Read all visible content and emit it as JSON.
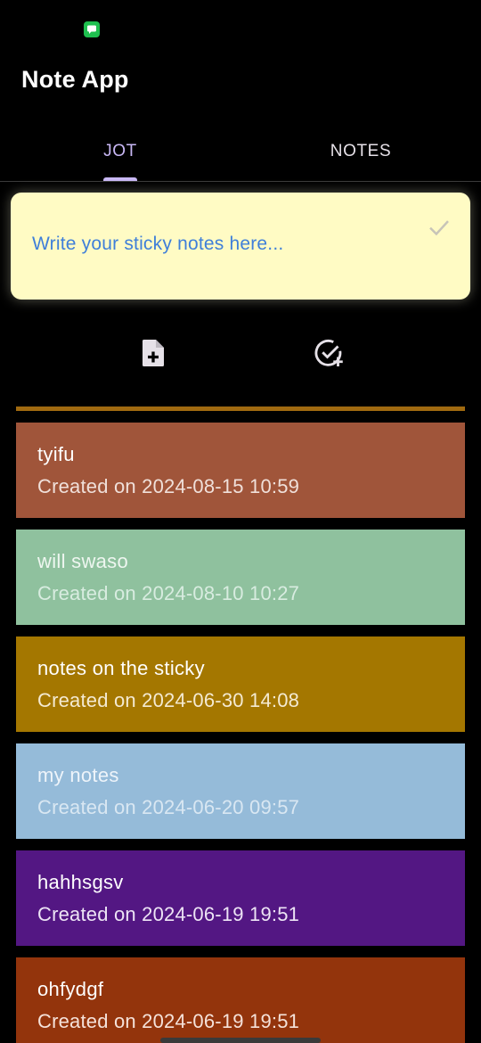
{
  "status_bar": {
    "app_icon": "chat-bubble-icon",
    "app_icon_color": "#1fbf4f"
  },
  "app": {
    "title": "Note App"
  },
  "tabs": [
    {
      "label": "JOT",
      "selected": true
    },
    {
      "label": "NOTES",
      "selected": false
    }
  ],
  "jot": {
    "placeholder": "Write your sticky notes here...",
    "confirm_icon": "check-icon",
    "actions": [
      {
        "icon": "add-note-file-icon"
      },
      {
        "icon": "add-task-check-circle-icon"
      }
    ]
  },
  "notes": [
    {
      "title": "tyifu",
      "date": "Created on 2024-08-15 10:59",
      "bg": "#a0553a",
      "title_color": "#ffffff",
      "date_color": "#f0e0da"
    },
    {
      "title": "will swaso",
      "date": "Created on 2024-08-10 10:27",
      "bg": "#8fc19e",
      "title_color": "#eef6f0",
      "date_color": "#d8ece0"
    },
    {
      "title": "notes on the sticky",
      "date": "Created on 2024-06-30 14:08",
      "bg": "#a47700",
      "title_color": "#ffffff",
      "date_color": "#f4ead2"
    },
    {
      "title": "my notes",
      "date": "Created on 2024-06-20 09:57",
      "bg": "#95bbd9",
      "title_color": "#eef4fa",
      "date_color": "#d9e7f2"
    },
    {
      "title": "hahhsgsv",
      "date": "Created on 2024-06-19 19:51",
      "bg": "#531783",
      "title_color": "#ffffff",
      "date_color": "#ede4f5"
    },
    {
      "title": "ohfydgf",
      "date": "Created on 2024-06-19 19:51",
      "bg": "#93340c",
      "title_color": "#ffffff",
      "date_color": "#f5e2da"
    }
  ],
  "colors": {
    "accent": "#c9b8f5",
    "sticky_bg": "#fffbc4",
    "placeholder": "#3f7fd9",
    "divider_note": "#a06a10"
  }
}
